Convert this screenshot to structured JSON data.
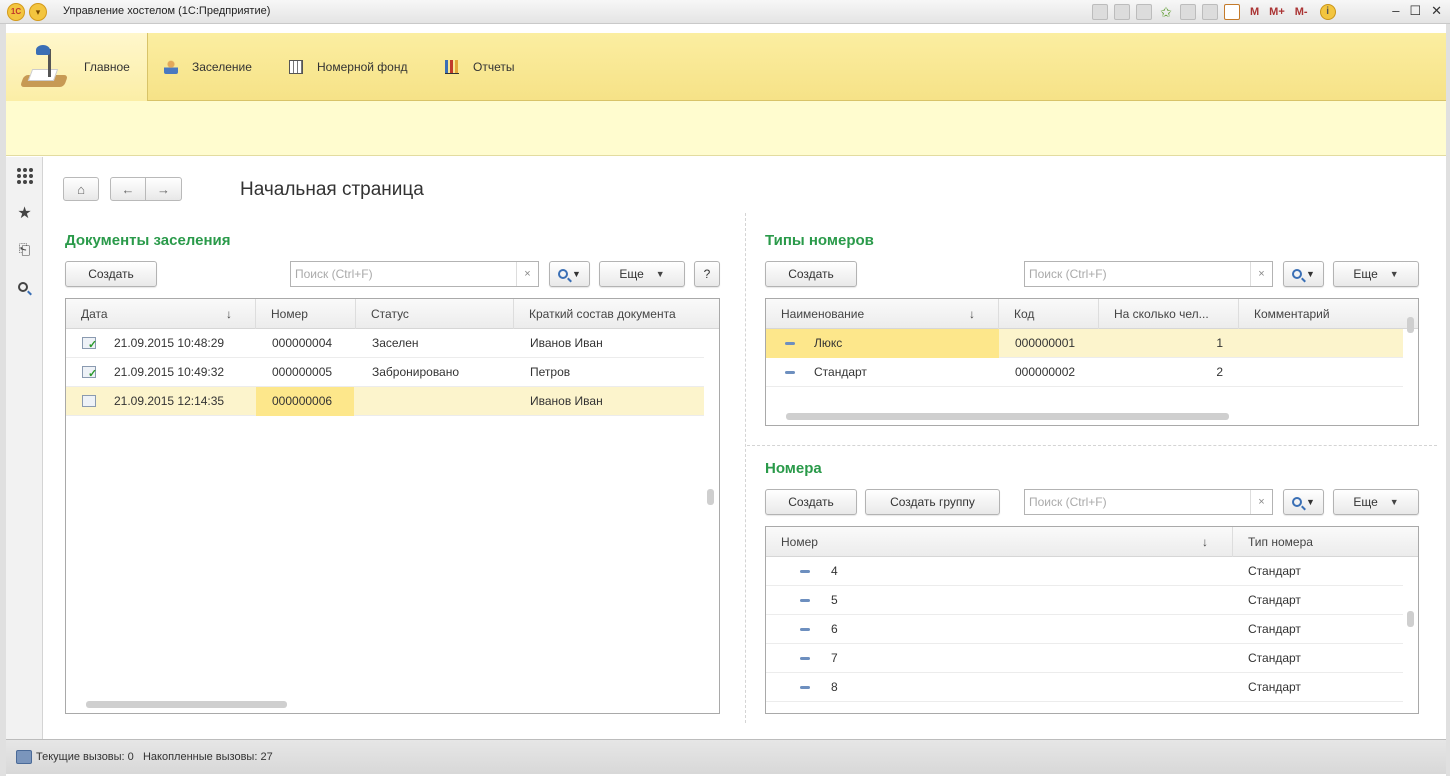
{
  "window": {
    "title": "Управление хостелом  (1С:Предприятие)",
    "logo_text": "1С",
    "toolbar_m": "M",
    "toolbar_mplus": "M+",
    "toolbar_mminus": "M-"
  },
  "sections": [
    {
      "label": "Главное",
      "icon": "desk-lamp-icon"
    },
    {
      "label": "Заселение",
      "icon": "person-icon"
    },
    {
      "label": "Номерной фонд",
      "icon": "grid-icon"
    },
    {
      "label": "Отчеты",
      "icon": "chart-icon"
    }
  ],
  "page": {
    "title": "Начальная страница"
  },
  "docs": {
    "title": "Документы заселения",
    "create": "Создать",
    "search_placeholder": "Поиск (Ctrl+F)",
    "more": "Еще",
    "help": "?",
    "columns": [
      "Дата",
      "Номер",
      "Статус",
      "Краткий состав документа"
    ],
    "rows": [
      {
        "date": "21.09.2015 10:48:29",
        "number": "000000004",
        "status": "Заселен",
        "summary": "Иванов Иван",
        "posted": true
      },
      {
        "date": "21.09.2015 10:49:32",
        "number": "000000005",
        "status": "Забронировано",
        "summary": "Петров",
        "posted": true
      },
      {
        "date": "21.09.2015 12:14:35",
        "number": "000000006",
        "status": "",
        "summary": "Иванов Иван",
        "posted": false
      }
    ]
  },
  "room_types": {
    "title": "Типы номеров",
    "create": "Создать",
    "search_placeholder": "Поиск (Ctrl+F)",
    "more": "Еще",
    "columns": [
      "Наименование",
      "Код",
      "На сколько чел...",
      "Комментарий"
    ],
    "rows": [
      {
        "name": "Люкс",
        "code": "000000001",
        "capacity": "1",
        "comment": ""
      },
      {
        "name": "Стандарт",
        "code": "000000002",
        "capacity": "2",
        "comment": ""
      }
    ]
  },
  "rooms": {
    "title": "Номера",
    "create": "Создать",
    "create_group": "Создать группу",
    "search_placeholder": "Поиск (Ctrl+F)",
    "more": "Еще",
    "columns": [
      "Номер",
      "Тип номера"
    ],
    "rows": [
      {
        "number": "4",
        "type": "Стандарт"
      },
      {
        "number": "5",
        "type": "Стандарт"
      },
      {
        "number": "6",
        "type": "Стандарт"
      },
      {
        "number": "7",
        "type": "Стандарт"
      },
      {
        "number": "8",
        "type": "Стандарт"
      }
    ]
  },
  "status": {
    "text": "Текущие вызовы: 0   Накопленные вызовы: 27"
  },
  "colors": {
    "accent_green": "#2a9a4a",
    "section_bar": "#f6e287",
    "selection": "#fcf4cc"
  }
}
